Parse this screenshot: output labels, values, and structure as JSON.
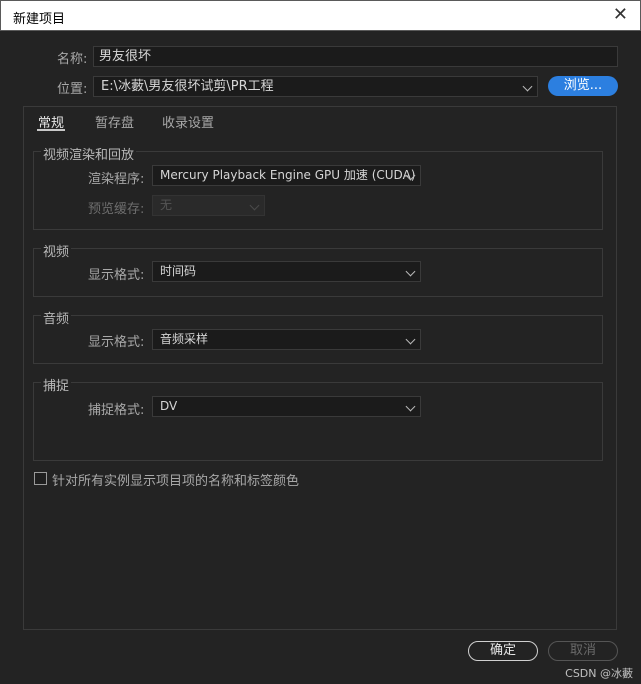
{
  "window": {
    "title": "新建项目",
    "close_glyph": "✕"
  },
  "name_label": "名称:",
  "name_value": "男友很坏",
  "location_label": "位置:",
  "location_value": "E:\\冰藪\\男友很坏试剪\\PR工程",
  "browse_label": "浏览...",
  "tabs": [
    {
      "label": "常规",
      "active": true
    },
    {
      "label": "暂存盘",
      "active": false
    },
    {
      "label": "收录设置",
      "active": false
    }
  ],
  "video_render": {
    "title": "视频渲染和回放",
    "renderer_label": "渲染程序:",
    "renderer_value": "Mercury Playback Engine GPU 加速 (CUDA)",
    "preview_cache_label": "预览缓存:",
    "preview_cache_value": "无"
  },
  "video": {
    "title": "视频",
    "display_format_label": "显示格式:",
    "display_format_value": "时间码"
  },
  "audio": {
    "title": "音频",
    "display_format_label": "显示格式:",
    "display_format_value": "音频采样"
  },
  "capture": {
    "title": "捕捉",
    "capture_format_label": "捕捉格式:",
    "capture_format_value": "DV"
  },
  "show_label_colors": {
    "label": "针对所有实例显示项目项的名称和标签颜色",
    "checked": false
  },
  "ok_label": "确定",
  "cancel_label": "取消",
  "watermark": "CSDN @冰藪",
  "colors": {
    "accent": "#2c7fe0",
    "background": "#232323"
  }
}
